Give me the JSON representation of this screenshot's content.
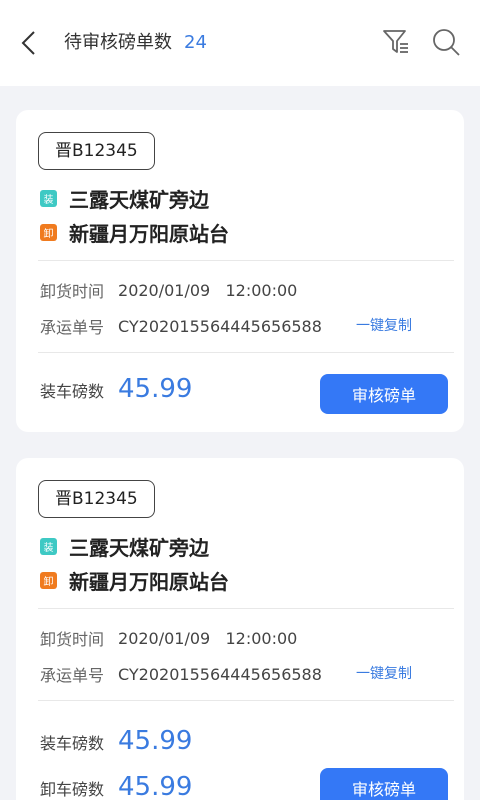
{
  "header": {
    "title": "待审核磅单数",
    "count": "24"
  },
  "cards": [
    {
      "plate": "晋B12345",
      "load_tag": "装",
      "load_place": "三露天煤矿旁边",
      "unload_tag": "卸",
      "unload_place": "新疆月万阳原站台",
      "unload_time_label": "卸货时间",
      "unload_time": "2020/01/09   12:00:00",
      "waybill_label": "承运单号",
      "waybill": "CY202015564445656588",
      "copy_label": "一键复制",
      "load_weight_label": "装车磅数",
      "load_weight": "45.99",
      "audit_label": "审核磅单"
    },
    {
      "plate": "晋B12345",
      "load_tag": "装",
      "load_place": "三露天煤矿旁边",
      "unload_tag": "卸",
      "unload_place": "新疆月万阳原站台",
      "unload_time_label": "卸货时间",
      "unload_time": "2020/01/09   12:00:00",
      "waybill_label": "承运单号",
      "waybill": "CY202015564445656588",
      "copy_label": "一键复制",
      "load_weight_label": "装车磅数",
      "load_weight": "45.99",
      "unload_weight_label": "卸车磅数",
      "unload_weight": "45.99",
      "audit_label": "审核磅单"
    }
  ],
  "colors": {
    "accent": "#3478f6",
    "load_tag": "#3ec9c4",
    "unload_tag": "#f07b1f"
  }
}
